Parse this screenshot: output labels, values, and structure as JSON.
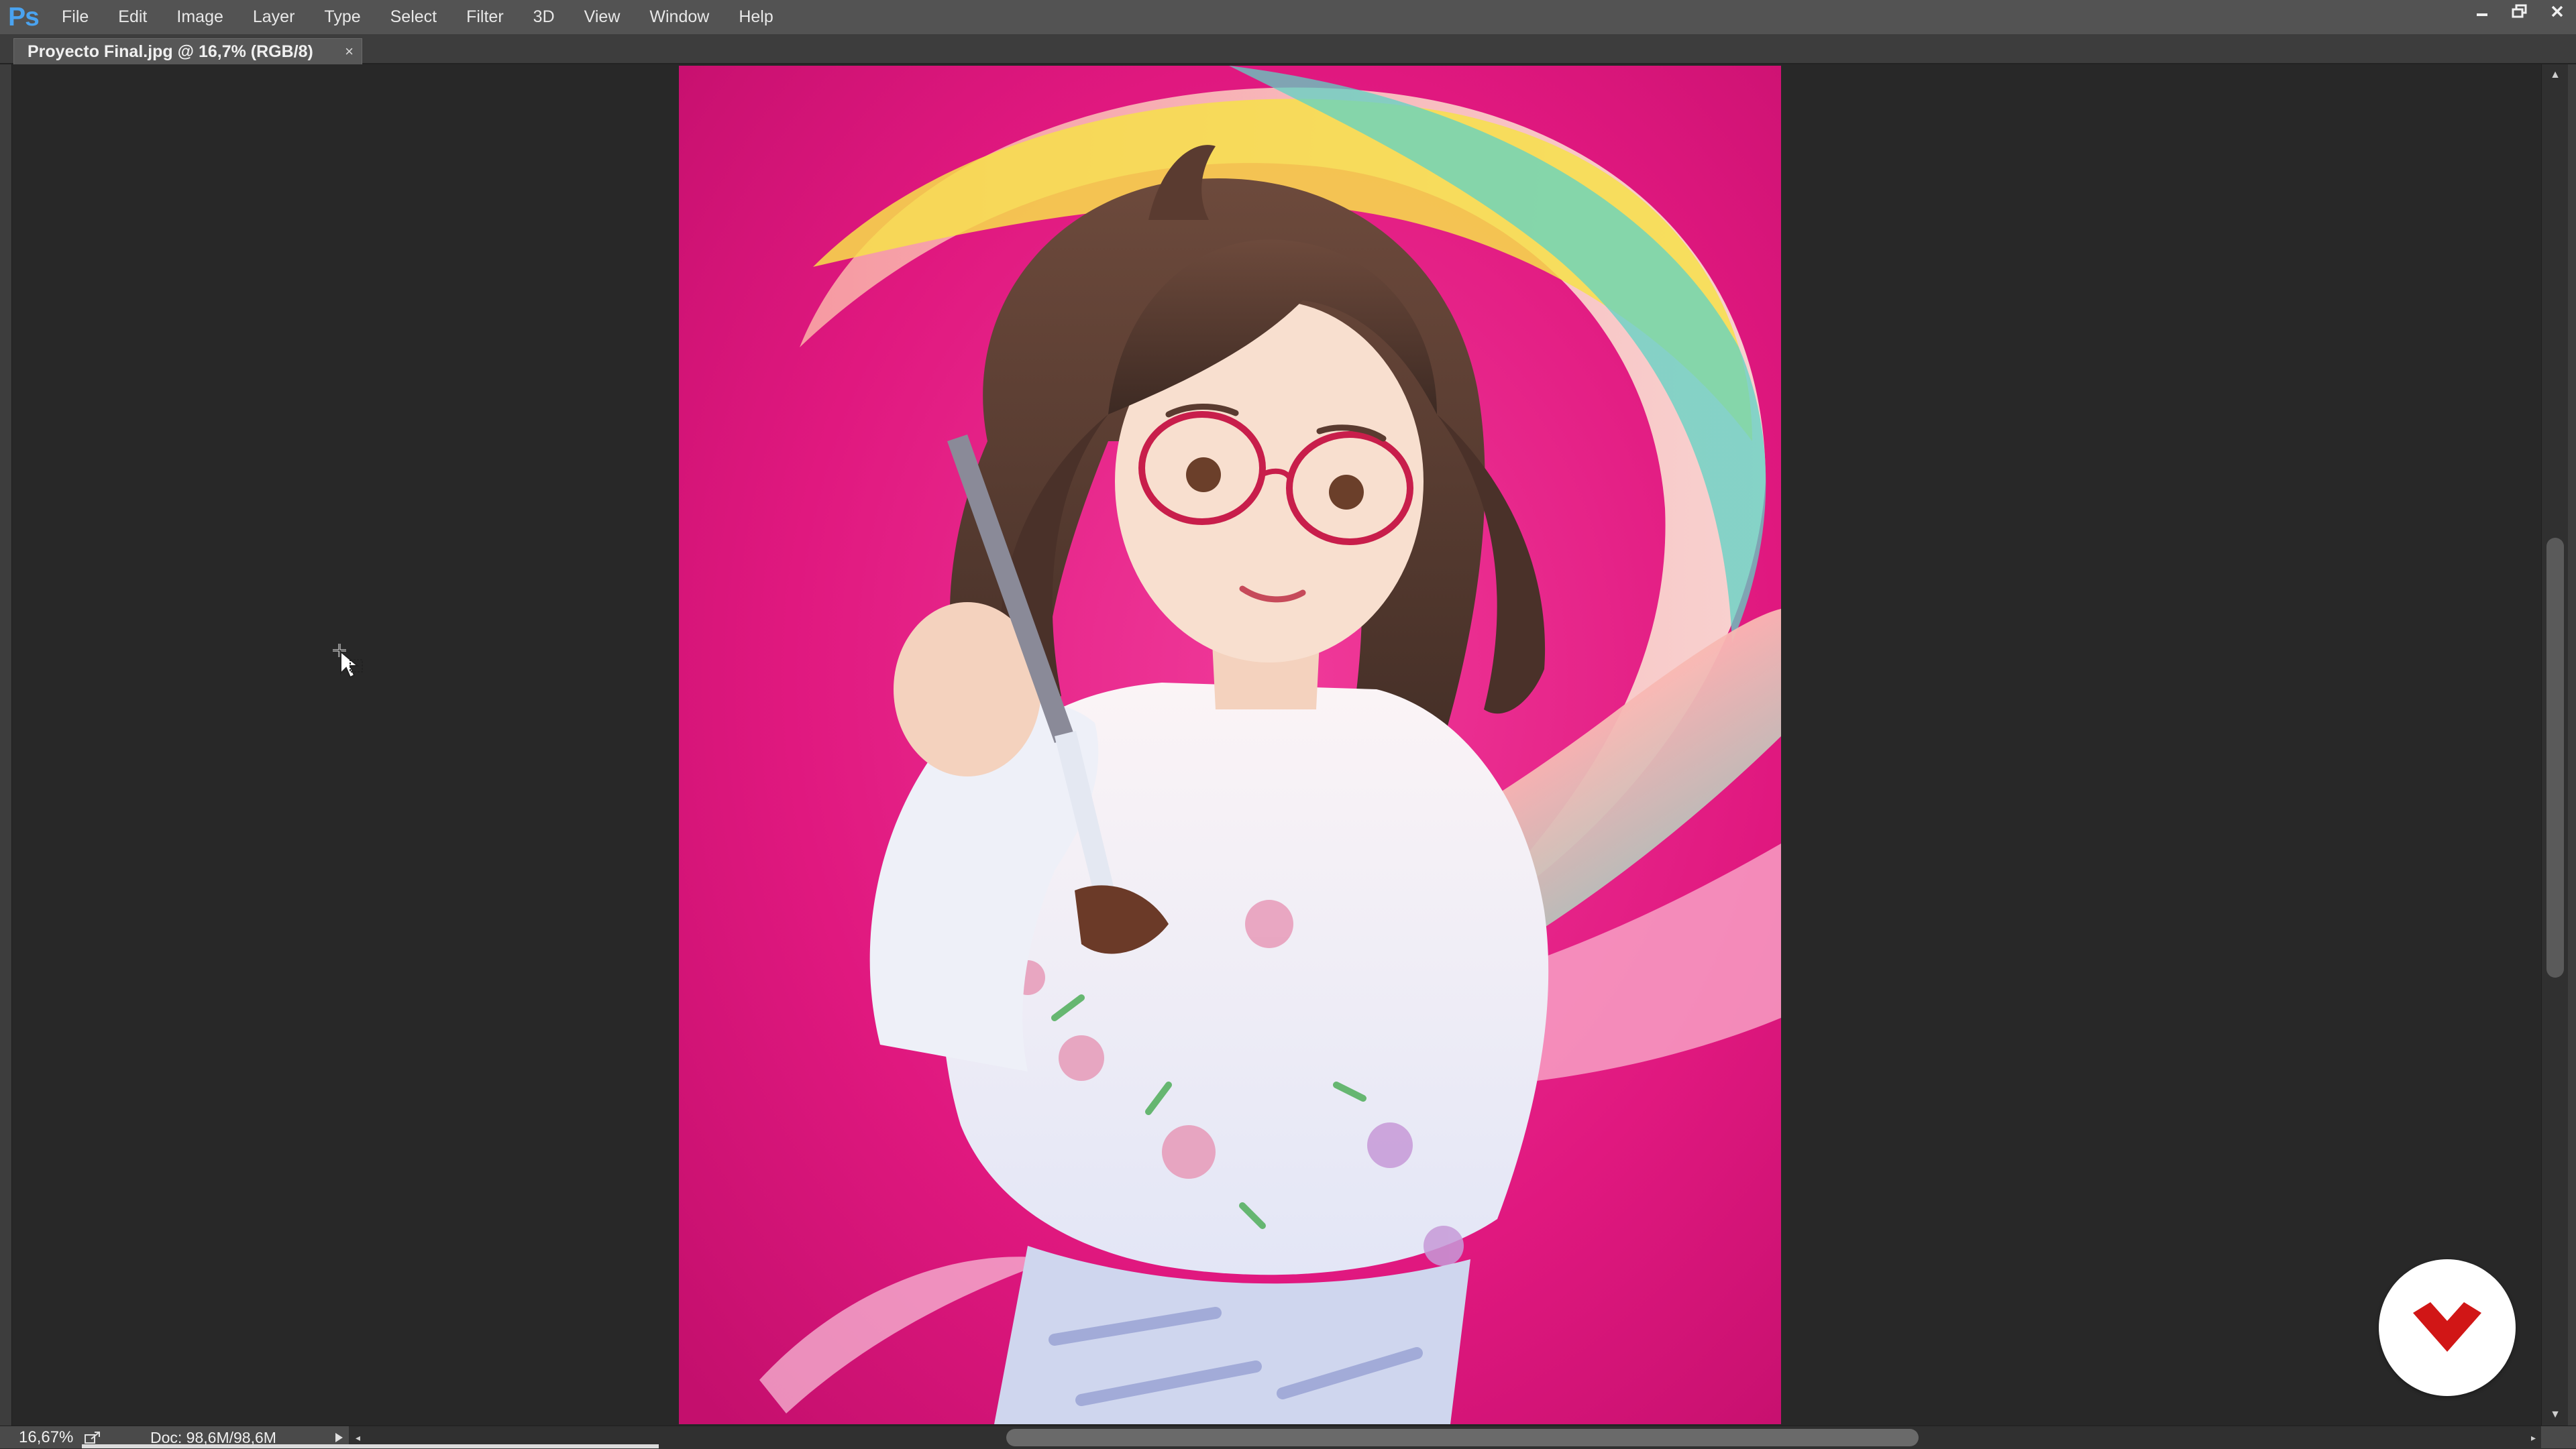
{
  "app": {
    "logo_text": "Ps",
    "menu": [
      "File",
      "Edit",
      "Image",
      "Layer",
      "Type",
      "Select",
      "Filter",
      "3D",
      "View",
      "Window",
      "Help"
    ]
  },
  "document": {
    "tab_title": "Proyecto Final.jpg @ 16,7% (RGB/8)",
    "tab_close": "×"
  },
  "status": {
    "zoom": "16,67%",
    "doc_size": "Doc: 98,6M/98,6M"
  },
  "scrollbars": {
    "vertical_position": 0.47,
    "horizontal_position": 0.46
  },
  "colors": {
    "menubar": "#535353",
    "canvas_bg": "#282828",
    "artwork_bg": "#e0187f",
    "logo_blue": "#4aa3f0",
    "watermark_red": "#d11616"
  },
  "icons": {
    "minimize": "minimize-icon",
    "restore": "restore-icon",
    "close": "close-icon",
    "cursor": "move-cursor-icon",
    "watermark": "brand-logo-icon"
  }
}
